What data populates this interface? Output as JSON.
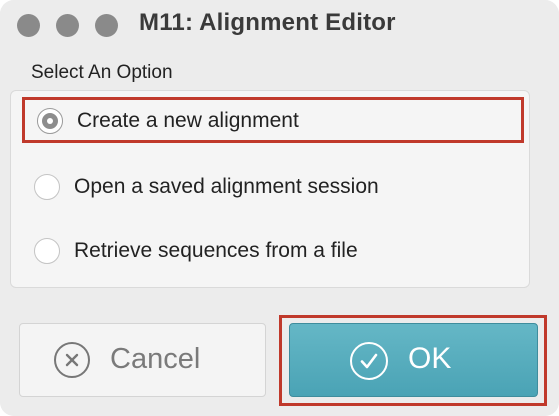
{
  "window": {
    "title": "M11: Alignment Editor",
    "controls": [
      "close-button",
      "minimize-button",
      "zoom-button"
    ]
  },
  "group": {
    "label": "Select An Option"
  },
  "options": [
    {
      "label": "Create a new alignment",
      "selected": true
    },
    {
      "label": "Open a saved alignment session",
      "selected": false
    },
    {
      "label": "Retrieve sequences from a file",
      "selected": false
    }
  ],
  "buttons": {
    "cancel": {
      "label": "Cancel",
      "icon": "cancel-icon"
    },
    "ok": {
      "label": "OK",
      "icon": "check-icon"
    }
  },
  "colors": {
    "highlight_border": "#c0392b",
    "ok_button": "#55aabc",
    "traffic_light": "#8a8a8a"
  }
}
